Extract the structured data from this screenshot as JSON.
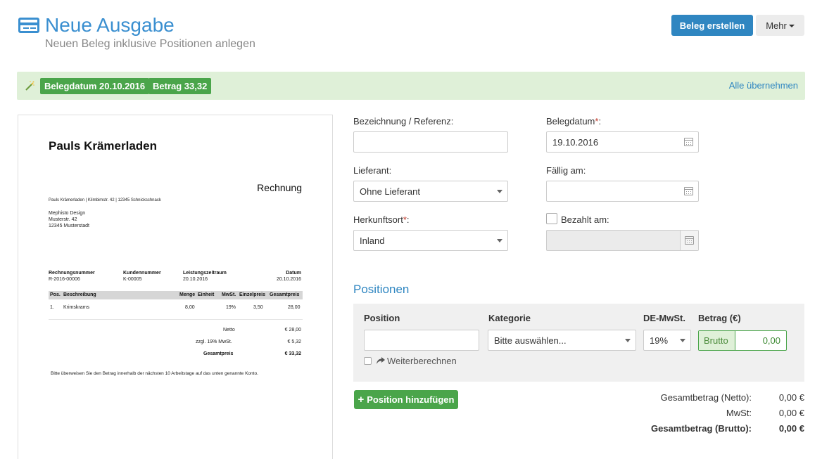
{
  "header": {
    "icon": "credit-card-icon",
    "title": "Neue Ausgabe",
    "subtitle": "Neuen Beleg inklusive Positionen anlegen",
    "create_button": "Beleg erstellen",
    "more_button": "Mehr"
  },
  "suggestions": {
    "icon": "magic-wand-icon",
    "date_badge": "Belegdatum 20.10.2016",
    "amount_badge": "Betrag 33,32",
    "apply_all_link": "Alle übernehmen"
  },
  "document": {
    "company": "Pauls Krämerladen",
    "invoice_title": "Rechnung",
    "sender_line": "Pauls Krämerladen | Klimbimstr. 42 | 12345 Schnickschnack",
    "recipient": [
      "Mephisto Design",
      "Musterstr. 42",
      "12345 Musterstadt"
    ],
    "meta_headers": [
      "Rechnungsnummer",
      "Kundennummer",
      "Leistungszeitraum",
      "Datum"
    ],
    "meta_values": [
      "R-2016-00006",
      "K-00005",
      "20.10.2016",
      "20.10.2016"
    ],
    "table_headers": [
      "Pos.",
      "Beschreibung",
      "Menge",
      "Einheit",
      "MwSt.",
      "Einzelpreis",
      "Gesamtpreis"
    ],
    "row": [
      "1.",
      "Krimskrams",
      "8,00",
      "19%",
      "3,50",
      "28,00"
    ],
    "netto_label": "Netto",
    "netto_value": "€ 28,00",
    "tax_label": "zzgl. 19% MwSt.",
    "tax_value": "€ 5,32",
    "total_label": "Gesamtpreis",
    "total_value": "€ 33,32",
    "footer": "Bitte überweisen Sie den Betrag innerhalb der nächsten 10 Arbeitstage auf das unten genannte Konto."
  },
  "form": {
    "reference_label": "Bezeichnung / Referenz:",
    "reference_value": "",
    "date_label": "Belegdatum",
    "date_value": "19.10.2016",
    "supplier_label": "Lieferant:",
    "supplier_value": "Ohne Lieferant",
    "due_label": "Fällig am:",
    "due_value": "",
    "origin_label": "Herkunftsort",
    "origin_value": "Inland",
    "paid_label": "Bezahlt am:",
    "paid_value": "",
    "required_mark": "*",
    "colon": ":"
  },
  "positions": {
    "title": "Positionen",
    "col_position": "Position",
    "col_category": "Kategorie",
    "col_tax": "DE-MwSt.",
    "col_amount": "Betrag (€)",
    "category_value": "Bitte auswählen...",
    "tax_value": "19%",
    "brutto_label": "Brutto",
    "amount_value": "0,00",
    "recalc_label": "Weiterberechnen",
    "add_button": "Position hinzufügen"
  },
  "totals": {
    "net_label": "Gesamtbetrag (Netto):",
    "net_value": "0,00 €",
    "tax_label": "MwSt:",
    "tax_value": "0,00 €",
    "gross_label": "Gesamtbetrag (Brutto):",
    "gross_value": "0,00 €"
  },
  "colors": {
    "primary": "#2f86c1",
    "success": "#4aa54a",
    "suggest_bg": "#dff0d8"
  }
}
